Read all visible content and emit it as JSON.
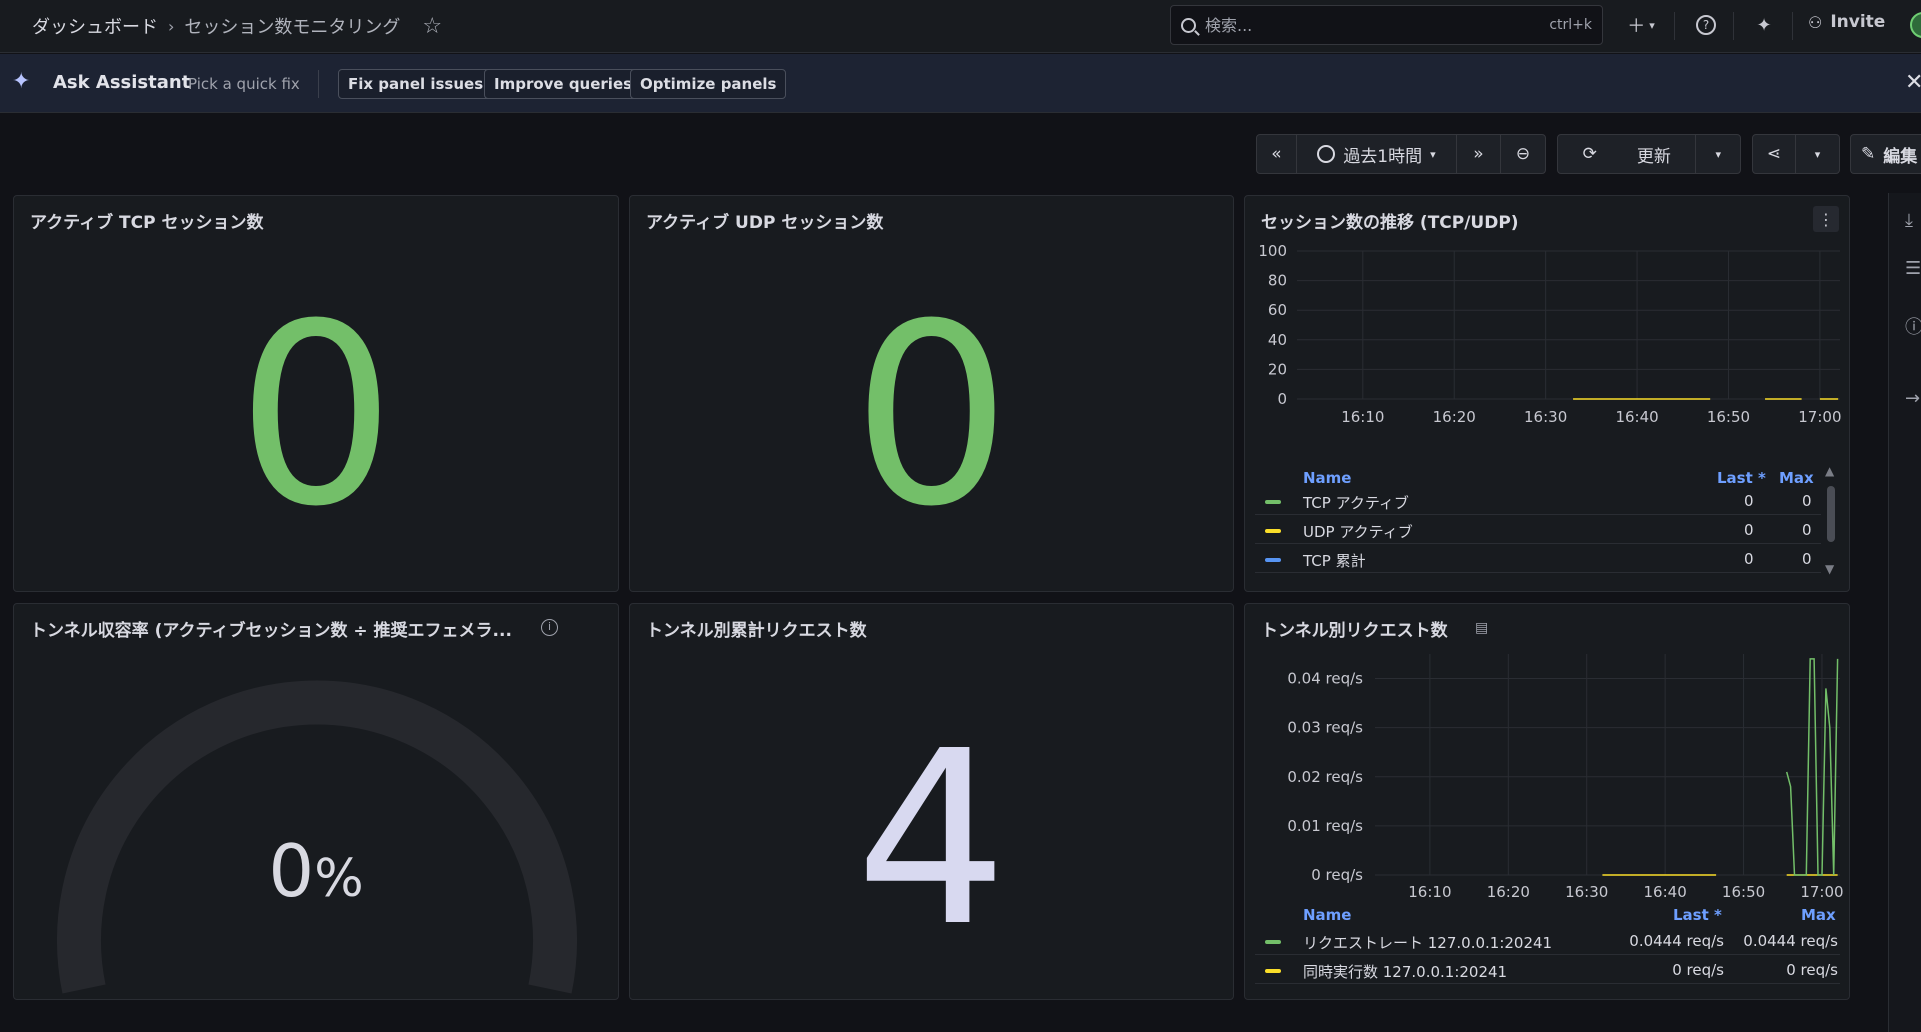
{
  "topnav": {
    "breadcrumb_root": "ダッシュボード",
    "breadcrumb_sep": "›",
    "breadcrumb_current": "セッション数モニタリング",
    "search_placeholder": "検索...",
    "search_shortcut": "ctrl+k",
    "invite_label": "Invite"
  },
  "assistant": {
    "title": "Ask Assistant",
    "subtitle": "Pick a quick fix",
    "chips": [
      "Fix panel issues",
      "Improve queries",
      "Optimize panels"
    ]
  },
  "toolbar": {
    "time_range": "過去1時間",
    "refresh_label": "更新",
    "edit_label": "編集"
  },
  "panels": {
    "tcp": {
      "title": "アクティブ TCP セッション数",
      "value": "0"
    },
    "udp": {
      "title": "アクティブ UDP セッション数",
      "value": "0"
    },
    "sessions": {
      "title": "セッション数の推移 (TCP/UDP)",
      "legend_headers": {
        "name": "Name",
        "last": "Last *",
        "max": "Max"
      },
      "legend": [
        {
          "name": "TCP アクティブ",
          "last": "0",
          "max": "0",
          "color": "#73bf69"
        },
        {
          "name": "UDP アクティブ",
          "last": "0",
          "max": "0",
          "color": "#fade2a"
        },
        {
          "name": "TCP 累計",
          "last": "0",
          "max": "0",
          "color": "#5794f2"
        }
      ]
    },
    "tunnel_capacity": {
      "title": "トンネル収容率 (アクティブセッション数 ÷ 推奨エフェメラ...",
      "value": "0",
      "unit": "%",
      "gauge_fraction": 0.0
    },
    "tunnel_total": {
      "title": "トンネル別累計リクエスト数",
      "value": "4"
    },
    "tunnel_requests": {
      "title": "トンネル別リクエスト数",
      "legend_headers": {
        "name": "Name",
        "last": "Last *",
        "max": "Max"
      },
      "legend": [
        {
          "name": "リクエストレート 127.0.0.1:20241",
          "last": "0.0444 req/s",
          "max": "0.0444 req/s",
          "color": "#73bf69"
        },
        {
          "name": "同時実行数 127.0.0.1:20241",
          "last": "0 req/s",
          "max": "0 req/s",
          "color": "#fade2a"
        }
      ]
    }
  },
  "chart_data": [
    {
      "type": "line",
      "title": "セッション数の推移 (TCP/UDP)",
      "x_ticks": [
        "16:10",
        "16:20",
        "16:30",
        "16:40",
        "16:50",
        "17:00"
      ],
      "y_ticks": [
        "0",
        "20",
        "40",
        "60",
        "80",
        "100"
      ],
      "ylim": [
        0,
        100
      ],
      "series": [
        {
          "name": "TCP アクティブ",
          "values": [
            0,
            0,
            0,
            0,
            0,
            0
          ]
        },
        {
          "name": "UDP アクティブ",
          "values": [
            0,
            0,
            0,
            0,
            0,
            0
          ]
        },
        {
          "name": "TCP 累計",
          "values": [
            0,
            0,
            0,
            0,
            0,
            0
          ]
        }
      ]
    },
    {
      "type": "line",
      "title": "トンネル別リクエスト数",
      "x_ticks": [
        "16:10",
        "16:20",
        "16:30",
        "16:40",
        "16:50",
        "17:00"
      ],
      "y_ticks": [
        "0 req/s",
        "0.01 req/s",
        "0.02 req/s",
        "0.03 req/s",
        "0.04 req/s"
      ],
      "ylim": [
        0,
        0.045
      ],
      "series": [
        {
          "name": "リクエストレート 127.0.0.1:20241",
          "x_minutes": [
            55.5,
            56.0,
            56.5,
            58.0,
            58.5,
            59.0,
            59.5,
            60.0,
            60.5,
            61.0,
            61.5,
            62.0
          ],
          "values": [
            0.021,
            0.018,
            0.0,
            0.0,
            0.044,
            0.044,
            0.0,
            0.0,
            0.038,
            0.03,
            0.0,
            0.044
          ]
        },
        {
          "name": "同時実行数 127.0.0.1:20241",
          "x_minutes": [
            32,
            46,
            55,
            60,
            62
          ],
          "values": [
            0,
            0,
            0,
            0,
            0
          ]
        }
      ]
    }
  ]
}
